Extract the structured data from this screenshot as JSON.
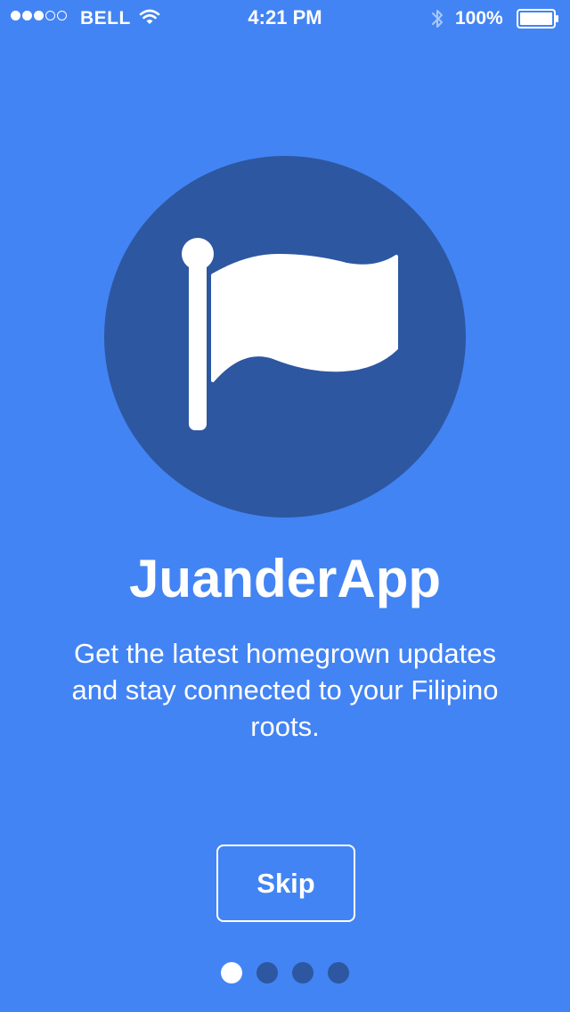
{
  "status_bar": {
    "carrier": "BELL",
    "time": "4:21 PM",
    "battery_percent": "100%",
    "signal_strength": 3,
    "signal_max": 5,
    "wifi_icon": "wifi-icon",
    "bluetooth_icon": "bluetooth-icon",
    "battery_level": 1.0
  },
  "onboarding": {
    "logo_icon": "flag-icon",
    "title": "JuanderApp",
    "description": "Get the latest homegrown updates and stay connected to your Filipino roots.",
    "skip_label": "Skip",
    "page_count": 4,
    "current_page": 1
  },
  "colors": {
    "background": "#4384F4",
    "circle": "#2D57A0",
    "dot_inactive": "#2D57A0",
    "dot_active": "#FFFFFF",
    "text": "#FFFFFF"
  }
}
